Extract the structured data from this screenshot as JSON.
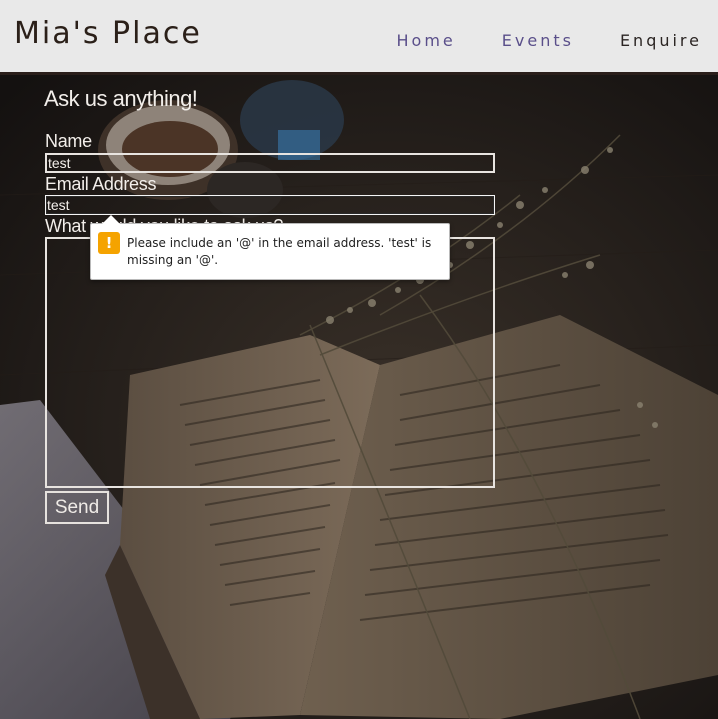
{
  "site": {
    "brand": "Mia's Place"
  },
  "nav": {
    "items": [
      {
        "label": "Home",
        "active": false
      },
      {
        "label": "Events",
        "active": false
      },
      {
        "label": "Enquire",
        "active": true
      }
    ]
  },
  "form": {
    "heading": "Ask us anything!",
    "name_label": "Name",
    "name_value": "test",
    "email_label": "Email Address",
    "email_value": "test",
    "question_label": "What would you like to ask us?",
    "question_value": "",
    "send_label": "Send"
  },
  "validation": {
    "icon": "warning-icon",
    "icon_glyph": "!",
    "message": "Please include an '@' in the email address. 'test' is missing an '@'.",
    "accent": "#f5a300"
  },
  "colors": {
    "header_bg": "#e9e9e9",
    "nav_link": "#5a4f8a",
    "nav_active": "#2b2523"
  }
}
